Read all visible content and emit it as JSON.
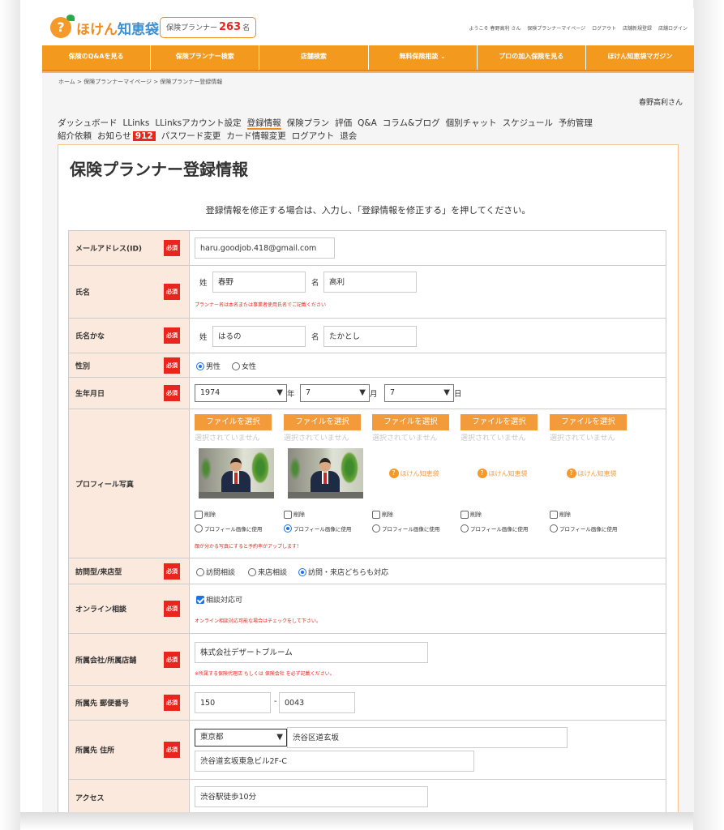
{
  "header": {
    "logo_text_kana": "ほけん",
    "logo_text_kanji": "知恵袋",
    "logo_mark": "?",
    "counter_label": "保険プランナー",
    "counter_value": "263",
    "counter_unit": "名",
    "links": [
      "ようこそ 春野高利 さん",
      "保険プランナーマイページ",
      "ログアウト",
      "店舗新規登録",
      "店舗ログイン"
    ]
  },
  "nav": {
    "items": [
      "保険のQ&Aを見る",
      "保険プランナー検索",
      "店舗検索",
      "無料保険相談 ⌄",
      "プロの加入保険を見る",
      "ほけん知恵袋マガジン"
    ]
  },
  "breadcrumb": "ホーム > 保険プランナーマイページ > 保険プランナー登録情報",
  "user_name": "春野高利さん",
  "menu": {
    "items": [
      "ダッシュボード",
      "LLinks",
      "LLinksアカウント設定",
      "登録情報",
      "保険プラン",
      "評価",
      "Q&A",
      "コラム&ブログ",
      "個別チャット",
      "スケジュール",
      "予約管理",
      "紹介依頼",
      "お知らせ"
    ],
    "badge": "912",
    "items2": [
      "パスワード変更",
      "カード情報変更",
      "ログアウト",
      "退会"
    ]
  },
  "page": {
    "title": "保険プランナー登録情報",
    "instruction": "登録情報を修正する場合は、入力し、「登録情報を修正する」を押してください。"
  },
  "required_label": "必須",
  "form": {
    "email": {
      "label": "メールアドレス(ID)",
      "value": "haru.goodjob.418@gmail.com"
    },
    "name": {
      "label": "氏名",
      "last_label": "姓",
      "last_value": "春野",
      "first_label": "名",
      "first_value": "高利",
      "note": "プランナー名は本名または事業者使用氏名でご記載ください"
    },
    "kana": {
      "label": "氏名かな",
      "last_label": "姓",
      "last_value": "はるの",
      "first_label": "名",
      "first_value": "たかとし"
    },
    "gender": {
      "label": "性別",
      "options": [
        "男性",
        "女性"
      ],
      "selected": "男性"
    },
    "birth": {
      "label": "生年月日",
      "year": "1974",
      "year_unit": "年",
      "month": "7",
      "month_unit": "月",
      "day": "7",
      "day_unit": "日"
    },
    "photo": {
      "label": "プロフィール写真",
      "button": "ファイルを選択",
      "no_file": "選択されていません",
      "delete": "削除",
      "use": "プロフィール画像に使用",
      "logo_text": "ほけん知恵袋",
      "note": "顔が分かる写真にすると予約率がアップします！",
      "selected_index": 1
    },
    "visit": {
      "label": "訪問型/来店型",
      "options": [
        "訪問相談",
        "来店相談",
        "訪問・来店どちらも対応"
      ],
      "selected": "訪問・来店どちらも対応"
    },
    "online": {
      "label": "オンライン相談",
      "checkbox": "相談対応可",
      "checked": true,
      "note": "オンライン相談対応可能な場合はチェックをして下さい。"
    },
    "company": {
      "label": "所属会社/所属店舗",
      "value": "株式会社デザートブルーム",
      "note": "※所属する保険代理店 もしくは 保険会社 を必ず記載ください。"
    },
    "zip": {
      "label": "所属先 郵便番号",
      "value1": "150",
      "sep": "-",
      "value2": "0043"
    },
    "address": {
      "label": "所属先 住所",
      "prefecture": "東京都",
      "city": "渋谷区道玄坂",
      "line2": "渋谷道玄坂東急ビル2F-C"
    },
    "access": {
      "label": "アクセス",
      "value": "渋谷駅徒歩10分"
    }
  },
  "colors": {
    "accent": "#f39a1e",
    "required": "#e8261e",
    "label_bg": "#fbe9dd"
  }
}
